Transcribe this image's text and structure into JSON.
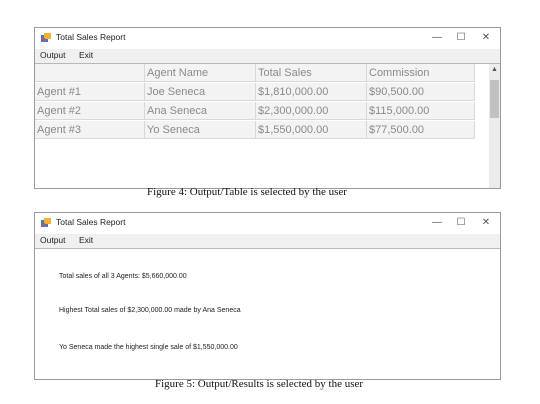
{
  "window1": {
    "title": "Total Sales Report",
    "controls": {
      "minimize": "—",
      "maximize": "☐",
      "close": "✕"
    },
    "menu": [
      "Output",
      "Exit"
    ],
    "table": {
      "columns": [
        "",
        "Agent Name",
        "Total Sales",
        "Commission"
      ],
      "rows": [
        [
          "Agent #1",
          "Joe Seneca",
          "$1,810,000.00",
          "$90,500.00"
        ],
        [
          "Agent #2",
          "Ana Seneca",
          "$2,300,000.00",
          "$115,000.00"
        ],
        [
          "Agent #3",
          "Yo Seneca",
          "$1,550,000.00",
          "$77,500.00"
        ]
      ]
    }
  },
  "caption1": "Figure 4: Output/Table is selected by the user",
  "window2": {
    "title": "Total Sales Report",
    "controls": {
      "minimize": "—",
      "maximize": "☐",
      "close": "✕"
    },
    "menu": [
      "Output",
      "Exit"
    ],
    "results": [
      "Total sales of all 3 Agents: $5,660,000.00",
      "Highest Total sales of $2,300,000.00 made by Ana Seneca",
      "Yo Seneca made the highest single sale of $1,550,000.00"
    ]
  },
  "caption2": "Figure 5: Output/Results is selected by the user"
}
